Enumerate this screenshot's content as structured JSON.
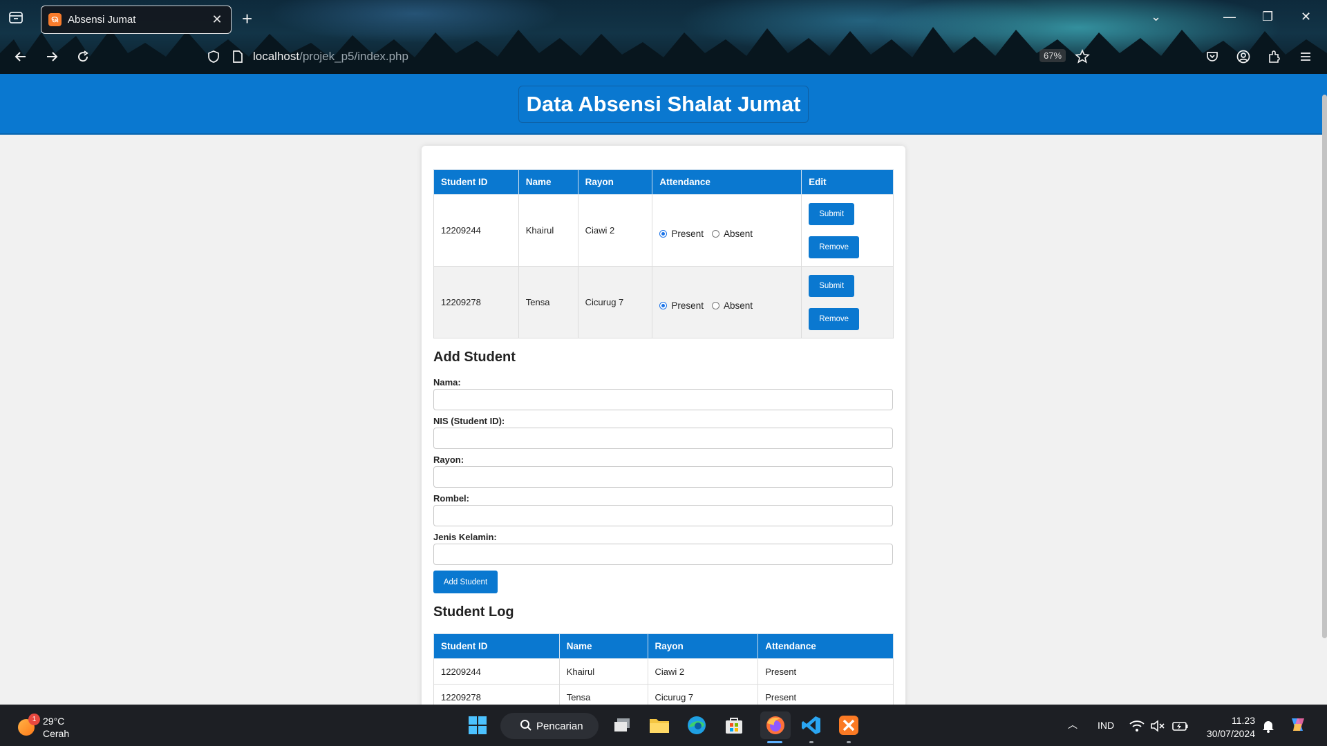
{
  "browser": {
    "tab_title": "Absensi Jumat",
    "url_host": "localhost",
    "url_path": "/projek_p5/index.php",
    "zoom": "67%"
  },
  "page": {
    "title": "Data Absensi Shalat Jumat"
  },
  "attendance_table": {
    "headers": [
      "Student ID",
      "Name",
      "Rayon",
      "Attendance",
      "Edit"
    ],
    "rows": [
      {
        "id": "12209244",
        "name": "Khairul",
        "rayon": "Ciawi 2",
        "present_label": "Present",
        "absent_label": "Absent",
        "selected": "Present",
        "submit": "Submit",
        "remove": "Remove"
      },
      {
        "id": "12209278",
        "name": "Tensa",
        "rayon": "Cicurug 7",
        "present_label": "Present",
        "absent_label": "Absent",
        "selected": "Present",
        "submit": "Submit",
        "remove": "Remove"
      }
    ]
  },
  "add_student": {
    "title": "Add Student",
    "fields": [
      {
        "label": "Nama:",
        "value": ""
      },
      {
        "label": "NIS (Student ID):",
        "value": ""
      },
      {
        "label": "Rayon:",
        "value": ""
      },
      {
        "label": "Rombel:",
        "value": ""
      },
      {
        "label": "Jenis Kelamin:",
        "value": ""
      }
    ],
    "button": "Add Student"
  },
  "student_log": {
    "title": "Student Log",
    "headers": [
      "Student ID",
      "Name",
      "Rayon",
      "Attendance"
    ],
    "rows": [
      {
        "id": "12209244",
        "name": "Khairul",
        "rayon": "Ciawi 2",
        "attendance": "Present"
      },
      {
        "id": "12209278",
        "name": "Tensa",
        "rayon": "Cicurug 7",
        "attendance": "Present"
      }
    ]
  },
  "taskbar": {
    "weather_temp": "29°C",
    "weather_desc": "Cerah",
    "weather_badge": "1",
    "search_label": "Pencarian",
    "language": "IND",
    "time": "11.23",
    "date": "30/07/2024"
  },
  "colors": {
    "accent": "#0a78d0",
    "page_bg": "#f1f1f1",
    "taskbar": "#1d1f24"
  }
}
